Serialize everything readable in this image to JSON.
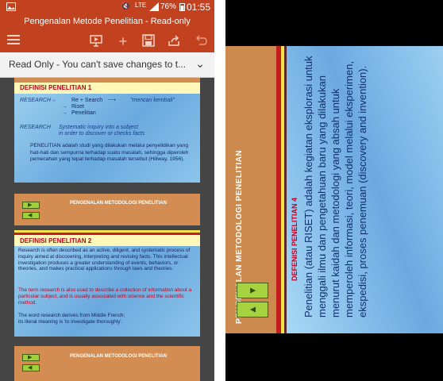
{
  "left_phone": {
    "status_bar": {
      "notification_icon": "image-icon",
      "network": "LTE",
      "battery": "76%",
      "time": "01:55"
    },
    "title": "Pengenalan Metode Penelitian - Read-only",
    "toolbar_icons": [
      "menu-icon",
      "present-icon",
      "add-icon",
      "save-icon",
      "share-icon",
      "undo-icon"
    ],
    "read_only_banner": "Read Only - You can't save changes to t...",
    "slides": [
      {
        "title": "DEFINISI PENELITIAN 1",
        "research_label": "RESEARCH",
        "re_search": "Re + Search",
        "mencari_kembali": "\"mencari kembali\"",
        "riset": "Riset",
        "penelitian": "Penelitian",
        "research_label2": "RESEARCH",
        "systematic_line1": "Systematic inquiry into a subject",
        "systematic_line2": "in order to discover or checks facts",
        "body": "PENELITIAN adalah studi yang dilakukan melalui penyelidikan yang hati-hati dan sempurna terhadap suatu masalah, sehingga diperoleh pemecahan yang tepat terhadap masalah tersebut (Hillway, 1956)."
      },
      {
        "band_title": "PENGENALAN METODOLOGI PENELITIAN"
      },
      {
        "title": "DEFINISI PENELITIAN 2",
        "para1": "Research is often described as an active, diligent, and systematic process of inquiry aimed at discovering, interpreting and revising facts. This intellectual investigation produces a greater understanding of events, behaviors, or theories, and makes practical applications through laws and theories.",
        "para2": "The term research is also used to describe a collection of information about a particular subject, and is usually associated with science and the scientific method.",
        "para3_line1": "The word research derives from Middle French;",
        "para3_line2": "its literal meaning is 'to investigate thoroughly'."
      },
      {
        "band_title": "PENGENALAN METODOLOGI PENELITIAN"
      }
    ]
  },
  "right_phone": {
    "band_title": "PENGENALAN METODOLOGI PENELITIAN",
    "definition_title": "DEFENISI PENELITIAN 4",
    "body": "Penelitian (atau RISET) adalah kegiatan eksplorasi untuk menggali ilmu dan pengetahuan baru yang dilakukan menurut kaidah dan metodologi yang absah untuk memperoleh informasi, teori, model melalui eksperimen, ekspedisi, proses penemuan (discovery and invention)."
  },
  "colors": {
    "accent": "#c2411f",
    "slide_brown": "#d38d52",
    "title_red": "#c4001f",
    "nav_green": "#9fd23a"
  }
}
